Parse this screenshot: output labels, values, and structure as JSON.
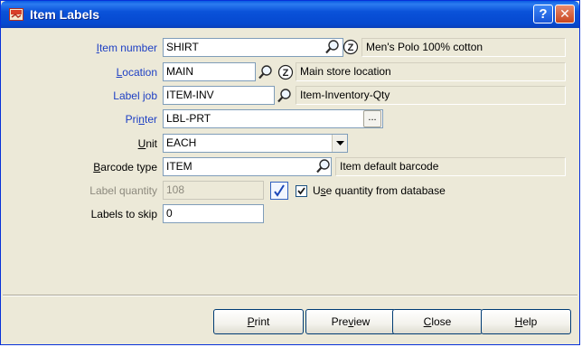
{
  "window": {
    "title": "Item Labels",
    "help_glyph": "?",
    "close_glyph": "✕"
  },
  "form": {
    "item_number": {
      "label_pre": "",
      "label_acc": "I",
      "label_post": "tem number",
      "value": "SHIRT",
      "description": "Men's Polo 100% cotton"
    },
    "location": {
      "label_pre": "",
      "label_acc": "L",
      "label_post": "ocation",
      "value": "MAIN",
      "description": "Main store location"
    },
    "label_job": {
      "label_pre": "Label ",
      "label_acc": "j",
      "label_post": "ob",
      "value": "ITEM-INV",
      "description": "Item-Inventory-Qty"
    },
    "printer": {
      "label_pre": "Pri",
      "label_acc": "n",
      "label_post": "ter",
      "value": "LBL-PRT",
      "browse_label": "..."
    },
    "unit": {
      "label_pre": "",
      "label_acc": "U",
      "label_post": "nit",
      "value": "EACH"
    },
    "barcode_type": {
      "label_pre": "",
      "label_acc": "B",
      "label_post": "arcode type",
      "value": "ITEM",
      "description": "Item default barcode"
    },
    "label_quantity": {
      "label": "Label quantity",
      "value": "108"
    },
    "use_quantity": {
      "label_pre": "U",
      "label_acc": "s",
      "label_post": "e quantity from database",
      "checked": true
    },
    "labels_to_skip": {
      "label": "Labels to skip",
      "value": "0"
    }
  },
  "buttons": {
    "print": {
      "pre": "",
      "acc": "P",
      "post": "rint"
    },
    "preview": {
      "pre": "Pre",
      "acc": "v",
      "post": "iew"
    },
    "close": {
      "pre": "",
      "acc": "C",
      "post": "lose"
    },
    "help": {
      "pre": "",
      "acc": "H",
      "post": "elp"
    }
  },
  "icons": {
    "lookup": "magnifier-icon",
    "zoom": "zoom-z-icon",
    "edit": "edit-pencil-icon",
    "window": "labels-app-icon"
  }
}
